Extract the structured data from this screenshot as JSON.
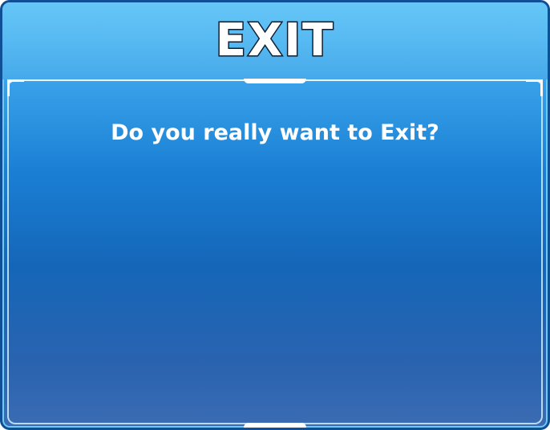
{
  "dialog": {
    "title": "EXIT",
    "message": "Do you really want to Exit?"
  },
  "colors": {
    "header": "#5fc0f5",
    "body_top": "#1a7fd4",
    "body_bottom": "#3b6cb3",
    "border": "#0e4f95",
    "title_outline": "#0e1e33",
    "text": "#ffffff"
  }
}
